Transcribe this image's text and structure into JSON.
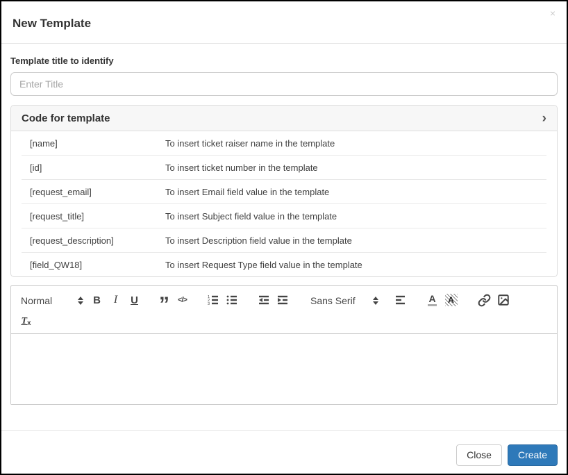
{
  "modal": {
    "title": "New Template",
    "close_glyph": "×"
  },
  "form": {
    "title_label": "Template title to identify",
    "title_placeholder": "Enter Title"
  },
  "code_panel": {
    "header": "Code for template",
    "chevron_glyph": "›",
    "rows": [
      {
        "code": "[name]",
        "description": "To insert ticket raiser name in the template"
      },
      {
        "code": "[id]",
        "description": "To insert ticket number in the template"
      },
      {
        "code": "[request_email]",
        "description": "To insert Email field value in the template"
      },
      {
        "code": "[request_title]",
        "description": "To insert Subject field value in the template"
      },
      {
        "code": "[request_description]",
        "description": "To insert Description field value in the template"
      },
      {
        "code": "[field_QW18]",
        "description": "To insert Request Type field value in the template"
      }
    ]
  },
  "editor": {
    "format_dropdown_value": "Normal",
    "font_dropdown_value": "Sans Serif",
    "bold_glyph": "B",
    "italic_glyph": "I",
    "underline_glyph": "U",
    "blockquote_glyph": "”",
    "code_glyph": "</>",
    "text_color_glyph": "A",
    "background_color_glyph": "A",
    "icons": [
      "header-picker",
      "bold",
      "italic",
      "underline",
      "blockquote",
      "code-block",
      "ordered-list",
      "bullet-list",
      "outdent",
      "indent",
      "font-picker",
      "align",
      "text-color",
      "background-color",
      "link",
      "image",
      "clear-format"
    ],
    "colors": {
      "icon": "#444444"
    }
  },
  "footer": {
    "close_label": "Close",
    "create_label": "Create",
    "create_color": "#2e79b9"
  }
}
